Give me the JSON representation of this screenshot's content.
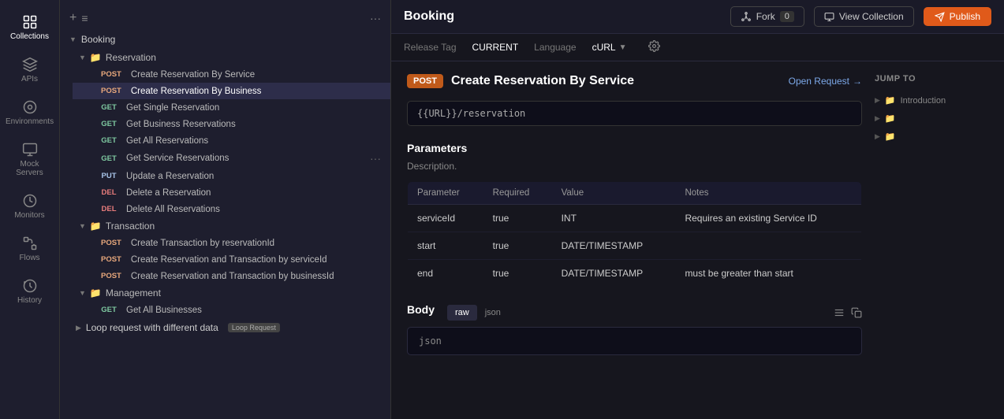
{
  "iconSidebar": {
    "items": [
      {
        "id": "collections",
        "label": "Collections",
        "active": true
      },
      {
        "id": "apis",
        "label": "APIs",
        "active": false
      },
      {
        "id": "environments",
        "label": "Environments",
        "active": false
      },
      {
        "id": "mock-servers",
        "label": "Mock Servers",
        "active": false
      },
      {
        "id": "monitors",
        "label": "Monitors",
        "active": false
      },
      {
        "id": "flows",
        "label": "Flows",
        "active": false
      },
      {
        "id": "history",
        "label": "History",
        "active": false
      }
    ]
  },
  "nav": {
    "addIcon": "+",
    "filterIcon": "≡",
    "moreIcon": "···",
    "collection": {
      "name": "Booking",
      "folders": [
        {
          "name": "Reservation",
          "endpoints": [
            {
              "method": "POST",
              "label": "Create Reservation By Service",
              "active": false
            },
            {
              "method": "POST",
              "label": "Create Reservation By Business",
              "active": true
            },
            {
              "method": "GET",
              "label": "Get Single Reservation",
              "active": false
            },
            {
              "method": "GET",
              "label": "Get Business Reservations",
              "active": false
            },
            {
              "method": "GET",
              "label": "Get All Reservations",
              "active": false
            },
            {
              "method": "GET",
              "label": "Get Service Reservations",
              "active": false,
              "showMore": true
            },
            {
              "method": "PUT",
              "label": "Update a Reservation",
              "active": false
            },
            {
              "method": "DEL",
              "label": "Delete a Reservation",
              "active": false
            },
            {
              "method": "DEL",
              "label": "Delete All Reservations",
              "active": false
            }
          ]
        },
        {
          "name": "Transaction",
          "endpoints": [
            {
              "method": "POST",
              "label": "Create Transaction by reservationId",
              "active": false
            },
            {
              "method": "POST",
              "label": "Create Reservation and Transaction by serviceId",
              "active": false
            },
            {
              "method": "POST",
              "label": "Create Reservation and Transaction by businessId",
              "active": false
            }
          ]
        },
        {
          "name": "Management",
          "endpoints": [
            {
              "method": "GET",
              "label": "Get All Businesses",
              "active": false
            }
          ]
        }
      ]
    },
    "loopRequest": {
      "label": "Loop request with different data",
      "tag": "Loop Request"
    }
  },
  "mainHeader": {
    "title": "Booking",
    "forkLabel": "Fork",
    "forkCount": "0",
    "viewCollectionLabel": "View Collection",
    "publishLabel": "Publish"
  },
  "tagBar": {
    "releaseTagLabel": "Release Tag",
    "releaseTagValue": "CURRENT",
    "languageLabel": "Language",
    "languageValue": "cURL"
  },
  "doc": {
    "methodBadge": "POST",
    "endpointTitle": "Create Reservation By Service",
    "openRequestLabel": "Open Request",
    "url": "{{URL}}/reservation",
    "parametersTitle": "Parameters",
    "parametersDesc": "Description.",
    "table": {
      "columns": [
        "Parameter",
        "Required",
        "Value",
        "Notes"
      ],
      "rows": [
        {
          "param": "serviceId",
          "required": "true",
          "value": "INT",
          "notes": "Requires an existing Service ID"
        },
        {
          "param": "start",
          "required": "true",
          "value": "DATE/TIMESTAMP",
          "notes": ""
        },
        {
          "param": "end",
          "required": "true",
          "value": "DATE/TIMESTAMP",
          "notes": "must be greater than start"
        }
      ]
    },
    "bodyTitle": "Body",
    "bodyTabs": [
      "raw",
      "json"
    ],
    "bodyActiveTab": "raw",
    "bodyContent": "json"
  },
  "jumpTo": {
    "title": "JUMP TO",
    "items": [
      {
        "label": "Introduction"
      },
      {
        "label": ""
      },
      {
        "label": ""
      }
    ]
  }
}
